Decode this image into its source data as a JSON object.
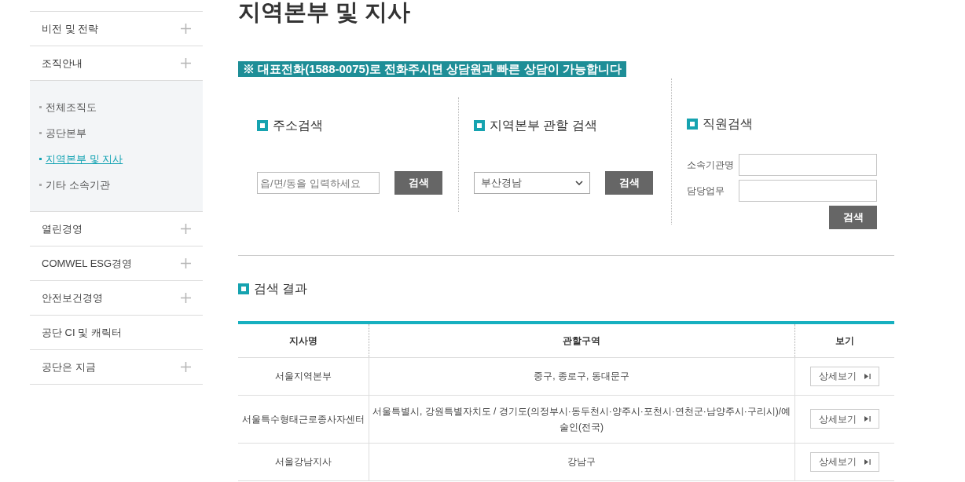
{
  "sidebar": {
    "items": [
      {
        "label": "비전 및 전략",
        "expandable": true,
        "expanded": false
      },
      {
        "label": "조직안내",
        "expandable": true,
        "expanded": true,
        "children": [
          {
            "label": "전체조직도",
            "selected": false
          },
          {
            "label": "공단본부",
            "selected": false
          },
          {
            "label": "지역본부 및 지사",
            "selected": true
          },
          {
            "label": "기타 소속기관",
            "selected": false
          }
        ]
      },
      {
        "label": "열린경영",
        "expandable": true,
        "expanded": false
      },
      {
        "label": "COMWEL ESG경영",
        "expandable": true,
        "expanded": false
      },
      {
        "label": "안전보건경영",
        "expandable": true,
        "expanded": false
      },
      {
        "label": "공단 CI 및 캐릭터",
        "expandable": false,
        "expanded": false
      },
      {
        "label": "공단은 지금",
        "expandable": true,
        "expanded": false
      }
    ]
  },
  "page_title": "지역본부 및 지사",
  "notice": "※ 대표전화(1588-0075)로 전화주시면 상담원과 빠른 상담이 가능합니다",
  "address_search": {
    "title": "주소검색",
    "placeholder": "읍/면/동을 입력하세요",
    "button": "검색"
  },
  "region_search": {
    "title": "지역본부 관할 검색",
    "value": "부산경남",
    "button": "검색"
  },
  "staff_search": {
    "title": "직원검색",
    "fields": [
      {
        "label": "소속기관명"
      },
      {
        "label": "담당업무"
      }
    ],
    "button": "검색"
  },
  "results": {
    "title": "검색 결과",
    "columns": [
      "지사명",
      "관할구역",
      "보기"
    ],
    "rows": [
      {
        "name": "서울지역본부",
        "area": "중구, 종로구, 동대문구",
        "button": "상세보기"
      },
      {
        "name": "서울특수형태근로종사자센터",
        "area": "서울특별시, 강원특별자치도 / 경기도(의정부시·동두천시·양주시·포천시·연천군·남양주시·구리시)/예술인(전국)",
        "button": "상세보기"
      },
      {
        "name": "서울강남지사",
        "area": "강남구",
        "button": "상세보기"
      }
    ]
  }
}
